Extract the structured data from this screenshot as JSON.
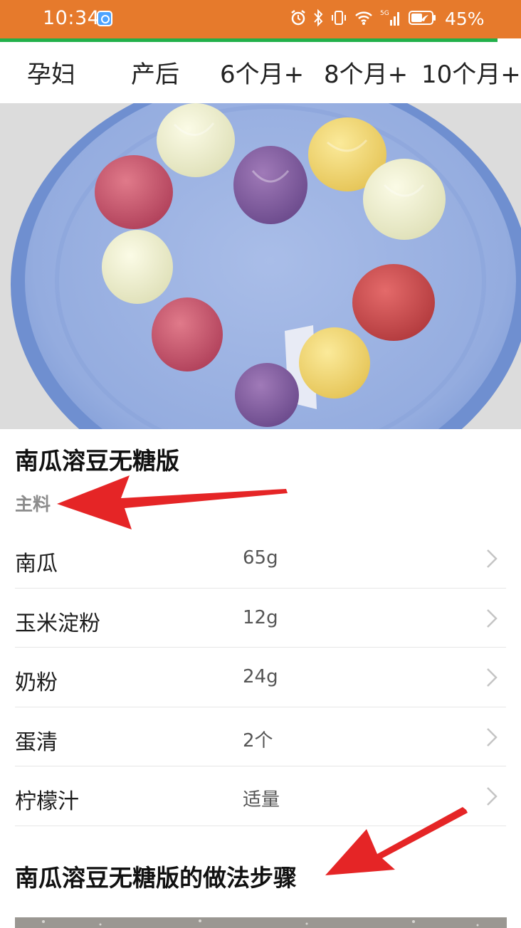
{
  "status_bar": {
    "time": "10:34",
    "battery": "45%",
    "network_label": "5G",
    "accent_color": "#e67a2c"
  },
  "load_progress": 0.955,
  "tabs": [
    {
      "label": "孕妇"
    },
    {
      "label": "产后"
    },
    {
      "label": "6个月+"
    },
    {
      "label": "8个月+"
    },
    {
      "label": "10个月+"
    }
  ],
  "recipe": {
    "title": "南瓜溶豆无糖版",
    "section_label": "主料",
    "ingredients": [
      {
        "name": "南瓜",
        "amount": "65g"
      },
      {
        "name": "玉米淀粉",
        "amount": "12g"
      },
      {
        "name": "奶粉",
        "amount": "24g"
      },
      {
        "name": "蛋清",
        "amount": "2个"
      },
      {
        "name": "柠檬汁",
        "amount": "适量"
      }
    ],
    "steps_title": "南瓜溶豆无糖版的做法步骤"
  },
  "annotation_color": "#e52526"
}
